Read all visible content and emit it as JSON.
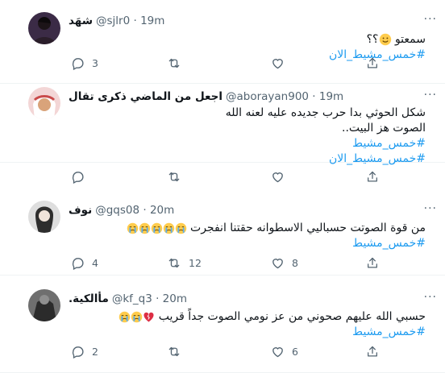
{
  "tweets": [
    {
      "name": "شهَد",
      "handle": "@sjlr0",
      "time": "19m",
      "lines": [
        {
          "text": "سمعتو",
          "suffix": "؟؟",
          "emoji": "smile"
        },
        {
          "tag": "#خمس_مشيط_الان"
        }
      ],
      "counts": {
        "reply": "3",
        "retweet": "",
        "like": "",
        "share": ""
      }
    },
    {
      "name": "اجعل من الماضي ذكرى تقال",
      "handle": "@aborayan900",
      "time": "19m",
      "lines": [
        {
          "text": "شكل الحوثي بدا حرب جديده عليه لعنه الله"
        },
        {
          "text": "الصوت هز البيت.."
        },
        {
          "tag": "#خمس_مشيط"
        },
        {
          "tag": "#خمس_مشيط_الان"
        }
      ],
      "counts": {
        "reply": "",
        "retweet": "",
        "like": "",
        "share": ""
      }
    },
    {
      "name": "نوف",
      "handle": "@gqs08",
      "time": "20m",
      "lines": [
        {
          "text": "من قوة الصوتت حسباليي الاسطوانه حقتنا انفجرت",
          "emoji": "cry5"
        },
        {
          "tag": "#خمس_مشيط"
        }
      ],
      "counts": {
        "reply": "4",
        "retweet": "12",
        "like": "8",
        "share": ""
      }
    },
    {
      "name": "مأالكية.",
      "handle": "@kf_q3",
      "time": "20m",
      "lines": [
        {
          "text": "حسبي الله عليهم صحوني من عز نومي الصوت جداً قريب",
          "emoji": "cry2heart"
        },
        {
          "tag": "#خمس_مشيط"
        }
      ],
      "counts": {
        "reply": "2",
        "retweet": "",
        "like": "6",
        "share": ""
      }
    }
  ],
  "icons": {
    "reply": "reply-icon",
    "retweet": "retweet-icon",
    "like": "like-icon",
    "share": "share-icon",
    "more": "more-options-icon"
  },
  "colors": {
    "hashtag": "#1d9bf0",
    "secondary": "#536471",
    "text": "#0f1419"
  }
}
